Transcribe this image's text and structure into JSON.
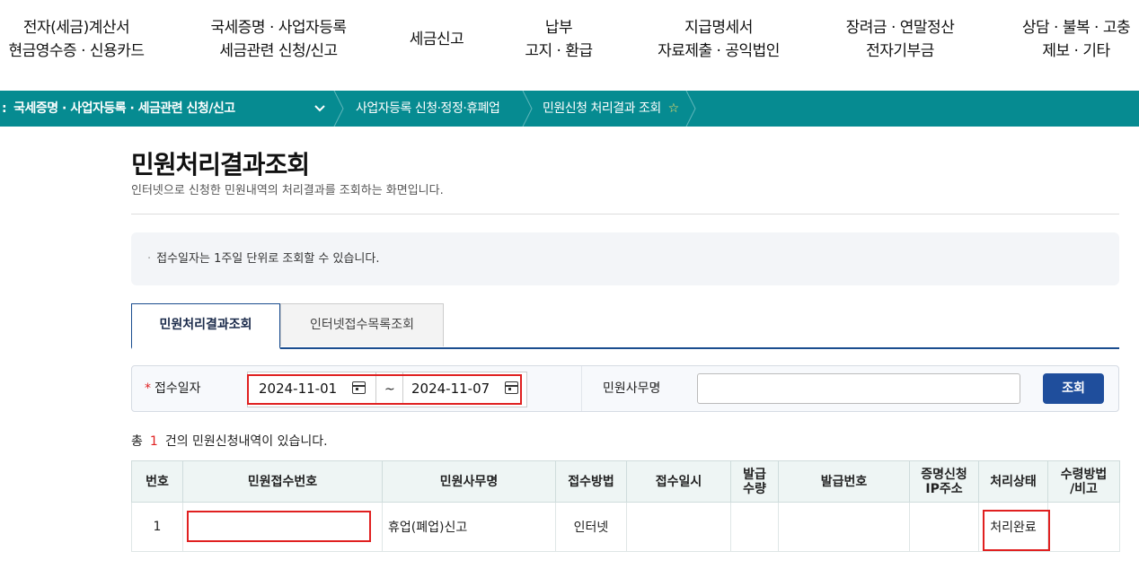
{
  "nav": [
    {
      "line1": "전자(세금)계산서",
      "line2": "현금영수증 · 신용카드"
    },
    {
      "line1": "국세증명 · 사업자등록",
      "line2": "세금관련 신청/신고"
    },
    {
      "line1": "세금신고",
      "line2": ""
    },
    {
      "line1": "납부",
      "line2": "고지 · 환급"
    },
    {
      "line1": "지급명세서",
      "line2": "자료제출 · 공익법인"
    },
    {
      "line1": "장려금 · 연말정산",
      "line2": "전자기부금"
    },
    {
      "line1": "상담 · 불복 · 고충",
      "line2": "제보 · 기타"
    }
  ],
  "breadcrumb": {
    "level1": "국세증명 · 사업자등록 · 세금관련 신청/신고",
    "level2": "사업자등록 신청·정정·휴폐업",
    "level3": "민원신청 처리결과 조회",
    "star": "☆"
  },
  "page": {
    "title": "민원처리결과조회",
    "subtitle": "인터넷으로 신청한 민원내역의 처리결과를 조회하는 화면입니다."
  },
  "notice": {
    "bullet": "·",
    "text": "접수일자는 1주일 단위로 조회할 수 있습니다."
  },
  "tabs": {
    "active": "민원처리결과조회",
    "inactive": "인터넷접수목록조회"
  },
  "search": {
    "required_mark": "*",
    "date_label": "접수일자",
    "date_from": "2024-11-01",
    "date_to": "2024-11-07",
    "tilde": "~",
    "office_label": "민원사무명",
    "office_value": "",
    "button": "조회"
  },
  "total": {
    "prefix": "총",
    "count": "1",
    "suffix": "건의 민원신청내역이 있습니다."
  },
  "table": {
    "headers": [
      "번호",
      "민원접수번호",
      "민원사무명",
      "접수방법",
      "접수일시",
      "발급\n수량",
      "발급번호",
      "증명신청\nIP주소",
      "처리상태",
      "수령방법\n/비고"
    ],
    "rows": [
      {
        "no": "1",
        "receipt_no": "",
        "office": "휴업(폐업)신고",
        "method": "인터넷",
        "datetime": "",
        "qty": "",
        "issue_no": "",
        "ip": "",
        "status": "처리완료",
        "note": ""
      }
    ]
  },
  "colors": {
    "crumb_bar": "#068b91",
    "accent": "#1f4e9c",
    "highlight": "#e02020"
  }
}
